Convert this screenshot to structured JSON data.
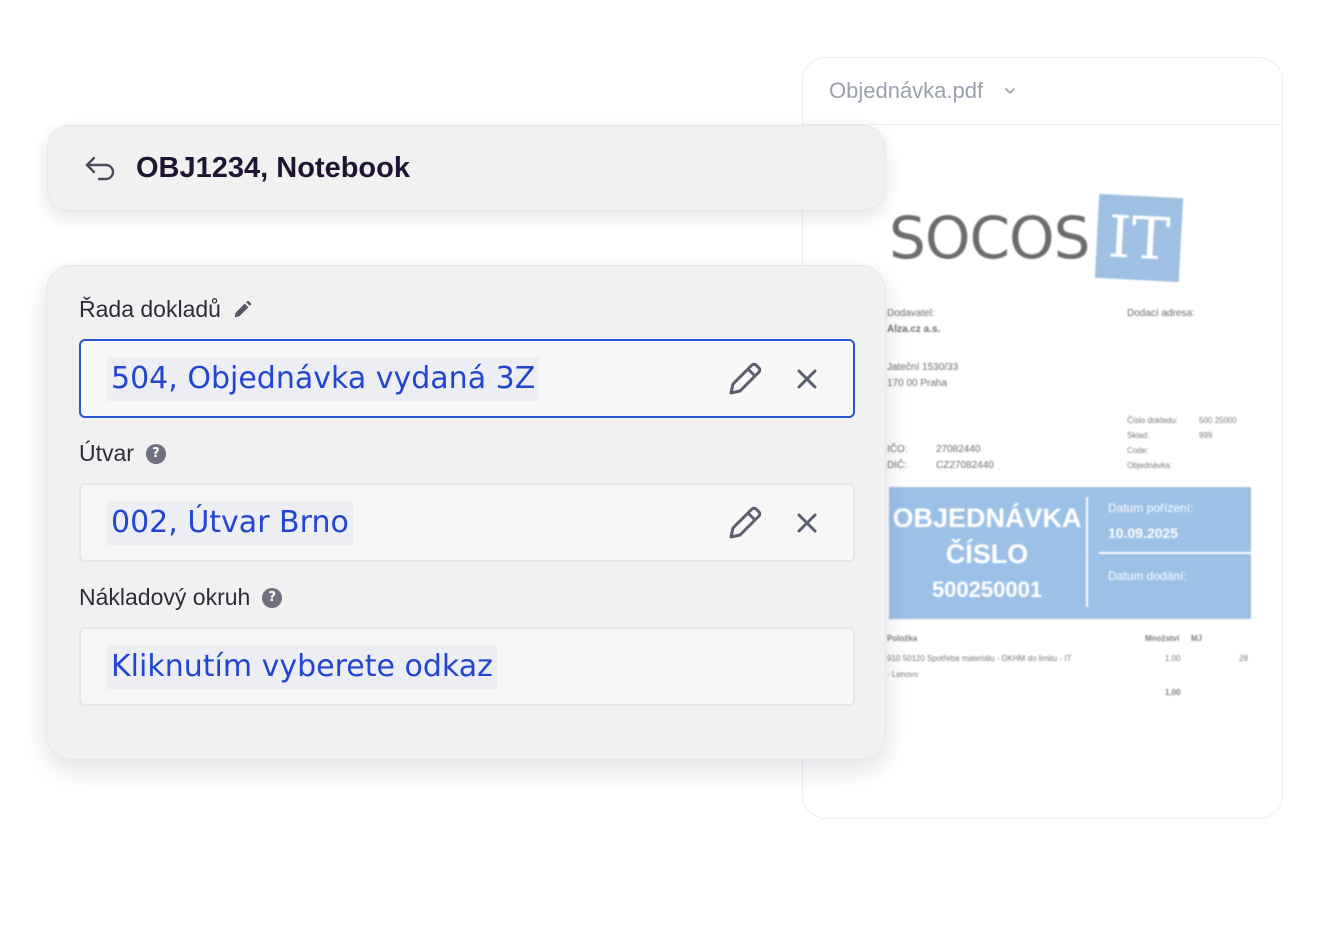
{
  "title_bar": {
    "title": "OBJ1234, Notebook",
    "back_icon": "back-arrow-icon"
  },
  "form": {
    "fields": [
      {
        "label": "Řada dokladů",
        "value": "504, Objednávka vydaná 3Z",
        "state": "focused"
      },
      {
        "label": "Útvar",
        "value": "002, Útvar Brno",
        "help": "?"
      },
      {
        "label": "Nákladový okruh",
        "value": "Kliknutím vyberete odkaz",
        "help": "?"
      }
    ]
  },
  "pdf_preview": {
    "file_name": "Objednávka.pdf",
    "document": {
      "logo_text": "SOCOS",
      "logo_badge": "IT",
      "supplier_label": "Dodavatel:",
      "supplier_name": "Alza.cz a.s.",
      "delivery_address_label": "Dodací adresa:",
      "address_line1": "Jateční 1530/33",
      "address_line2": "170 00 Praha",
      "doc_number_label": "Číslo dokladu:",
      "doc_number_value": "500 25000",
      "warehouse_label": "Sklad:",
      "warehouse_value": "999",
      "code_label": "Code:",
      "order_label": "Objednávka:",
      "ico_label": "IČO:",
      "ico_value": "27082440",
      "dic_label": "DIČ:",
      "dic_value": "CZ27082440",
      "box_title1": "OBJEDNÁVKA",
      "box_title2": "ČÍSLO",
      "box_number": "500250001",
      "date_created_label": "Datum pořízení:",
      "date_created_value": "10.09.2025",
      "delivery_date_label": "Datum dodání:",
      "col_item": "Položka",
      "col_qty": "Množství",
      "col_unit": "MJ",
      "row_text1": "910 50120 Spotřeba materiálu - DKHM do limitu - IT",
      "row_text2": "- Lenovo",
      "row_qty": "1,00",
      "row_unit": "28",
      "total_qty": "1,00"
    }
  },
  "colors": {
    "accent": "#2a55d1",
    "value_text": "#2346cf",
    "title_text": "#1f1533",
    "pdf_blue": "#9cc0e6"
  }
}
